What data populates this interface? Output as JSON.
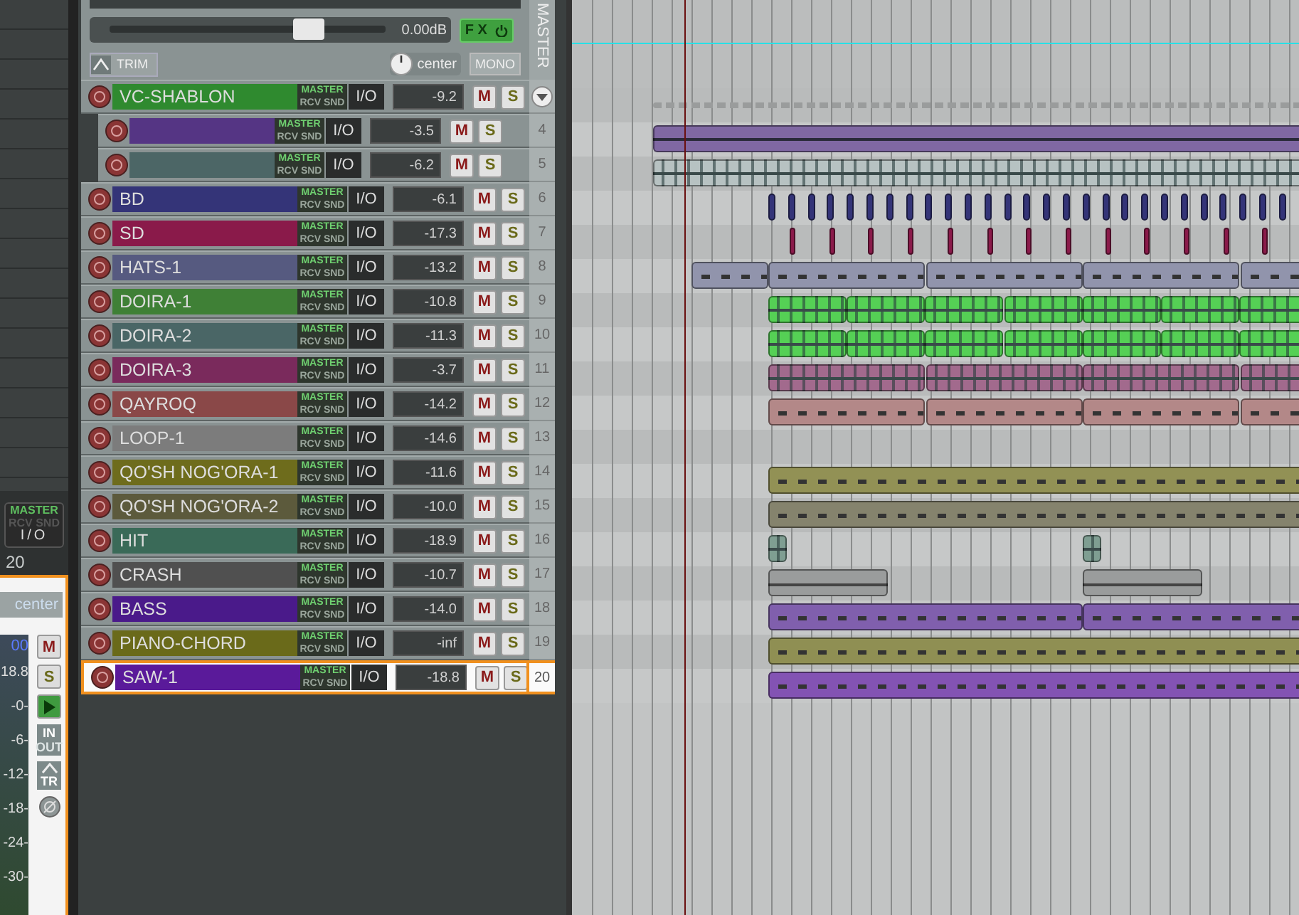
{
  "mixer_strip": {
    "routing_top": "MASTER",
    "routing_bottom": "RCV SND",
    "io": "I/O",
    "track_number": "20",
    "pan": "center",
    "volume": "00",
    "peak": "18.8",
    "scale": [
      "-0-",
      "-6-",
      "-12-",
      "-18-",
      "-24-",
      "-30-"
    ],
    "mute": "M",
    "solo": "S",
    "monitor_on": true,
    "input": "IN",
    "output": "OUT",
    "trim": "TR"
  },
  "master": {
    "volume": "0.00dB",
    "level": 0.72,
    "fx": "F X",
    "fx_on": true,
    "trim": "TRIM",
    "pan": "center",
    "mono": "MONO",
    "label": "MASTER"
  },
  "tracks": [
    {
      "name": "VC-SHABLON",
      "color": "#2f8a2f",
      "routing_top": "MASTER",
      "routing_bottom": "RCV SND",
      "io": "I/O",
      "reading": "-9.2",
      "mute": "M",
      "solo": "S",
      "selected": false,
      "lane": {
        "kind": "ghost"
      },
      "children": [
        {
          "color": "#553584",
          "routing_top": "MASTER",
          "routing_bottom": "RCV SND",
          "io": "I/O",
          "reading": "-3.5",
          "mute": "M",
          "solo": "S",
          "number": "4",
          "selected": false,
          "lane": {
            "kind": "sustain-early"
          }
        },
        {
          "color": "#4c6666",
          "routing_top": "MASTER",
          "routing_bottom": "RCV SND",
          "io": "I/O",
          "reading": "-6.2",
          "mute": "M",
          "solo": "S",
          "number": "5",
          "selected": false,
          "lane": {
            "kind": "wave-early"
          }
        }
      ]
    },
    {
      "name": "BD",
      "color": "#343478",
      "routing_top": "MASTER",
      "routing_bottom": "RCV SND",
      "io": "I/O",
      "reading": "-6.1",
      "mute": "M",
      "solo": "S",
      "number": "6",
      "selected": false,
      "lane": {
        "kind": "hits-dense"
      }
    },
    {
      "name": "SD",
      "color": "#8a1a4a",
      "routing_top": "MASTER",
      "routing_bottom": "RCV SND",
      "io": "I/O",
      "reading": "-17.3",
      "mute": "M",
      "solo": "S",
      "number": "7",
      "selected": false,
      "lane": {
        "kind": "hits-sparse"
      }
    },
    {
      "name": "HATS-1",
      "color": "#565a80",
      "routing_top": "MASTER",
      "routing_bottom": "RCV SND",
      "io": "I/O",
      "reading": "-13.2",
      "mute": "M",
      "solo": "S",
      "number": "8",
      "selected": false,
      "lane": {
        "kind": "loops-early"
      }
    },
    {
      "name": "DOIRA-1",
      "color": "#3f8036",
      "routing_top": "MASTER",
      "routing_bottom": "RCV SND",
      "io": "I/O",
      "reading": "-10.8",
      "mute": "M",
      "solo": "S",
      "number": "9",
      "selected": false,
      "lane": {
        "kind": "wave-loops"
      }
    },
    {
      "name": "DOIRA-2",
      "color": "#4a6666",
      "routing_top": "MASTER",
      "routing_bottom": "RCV SND",
      "io": "I/O",
      "reading": "-11.3",
      "mute": "M",
      "solo": "S",
      "number": "10",
      "selected": false,
      "lane": {
        "kind": "wave-loops"
      }
    },
    {
      "name": "DOIRA-3",
      "color": "#7a2a5c",
      "routing_top": "MASTER",
      "routing_bottom": "RCV SND",
      "io": "I/O",
      "reading": "-3.7",
      "mute": "M",
      "solo": "S",
      "number": "11",
      "selected": false,
      "lane": {
        "kind": "wave-bars"
      }
    },
    {
      "name": "QAYROQ",
      "color": "#8a4848",
      "routing_top": "MASTER",
      "routing_bottom": "RCV SND",
      "io": "I/O",
      "reading": "-14.2",
      "mute": "M",
      "solo": "S",
      "number": "12",
      "selected": false,
      "lane": {
        "kind": "midi-bars"
      }
    },
    {
      "name": "LOOP-1",
      "color": "#7c7c7c",
      "routing_top": "MASTER",
      "routing_bottom": "RCV SND",
      "io": "I/O",
      "reading": "-14.6",
      "mute": "M",
      "solo": "S",
      "number": "13",
      "selected": false,
      "lane": {
        "kind": "empty"
      }
    },
    {
      "name": "QO'SH NOG'ORA-1",
      "color": "#6e6c1c",
      "routing_top": "MASTER",
      "routing_bottom": "RCV SND",
      "io": "I/O",
      "reading": "-11.6",
      "mute": "M",
      "solo": "S",
      "number": "14",
      "selected": false,
      "lane": {
        "kind": "midi-long"
      }
    },
    {
      "name": "QO'SH NOG'ORA-2",
      "color": "#5c5a3c",
      "routing_top": "MASTER",
      "routing_bottom": "RCV SND",
      "io": "I/O",
      "reading": "-10.0",
      "mute": "M",
      "solo": "S",
      "number": "15",
      "selected": false,
      "lane": {
        "kind": "midi-long"
      }
    },
    {
      "name": "HIT",
      "color": "#3a6a58",
      "routing_top": "MASTER",
      "routing_bottom": "RCV SND",
      "io": "I/O",
      "reading": "-18.9",
      "mute": "M",
      "solo": "S",
      "number": "16",
      "selected": false,
      "lane": {
        "kind": "shots"
      }
    },
    {
      "name": "CRASH",
      "color": "#505050",
      "routing_top": "MASTER",
      "routing_bottom": "RCV SND",
      "io": "I/O",
      "reading": "-10.7",
      "mute": "M",
      "solo": "S",
      "number": "17",
      "selected": false,
      "lane": {
        "kind": "tails"
      }
    },
    {
      "name": "BASS",
      "color": "#4a1a8a",
      "routing_top": "MASTER",
      "routing_bottom": "RCV SND",
      "io": "I/O",
      "reading": "-14.0",
      "mute": "M",
      "solo": "S",
      "number": "18",
      "selected": false,
      "lane": {
        "kind": "midi-halves"
      }
    },
    {
      "name": "PIANO-CHORD",
      "color": "#6a6a1a",
      "routing_top": "MASTER",
      "routing_bottom": "RCV SND",
      "io": "I/O",
      "reading": "-inf",
      "mute": "M",
      "solo": "S",
      "number": "19",
      "selected": false,
      "lane": {
        "kind": "midi-long"
      }
    },
    {
      "name": "SAW-1",
      "color": "#5a1a9a",
      "routing_top": "MASTER",
      "routing_bottom": "RCV SND",
      "io": "I/O",
      "reading": "-18.8",
      "mute": "M",
      "solo": "S",
      "number": "20",
      "selected": true,
      "lane": {
        "kind": "midi-long"
      }
    }
  ]
}
